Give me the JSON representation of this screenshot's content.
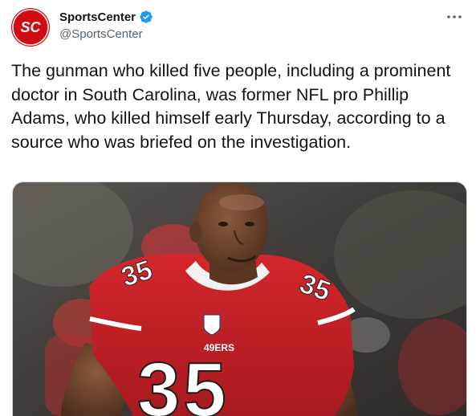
{
  "tweet": {
    "author": {
      "display_name": "SportsCenter",
      "handle": "@SportsCenter",
      "verified": true,
      "avatar_text": "SC"
    },
    "text": "The gunman who killed five people, including a prominent doctor in South Carolina, was former NFL pro Phillip Adams, who killed himself early Thursday, according to a source who was briefed on the investigation.",
    "media": {
      "jersey_number": "35",
      "jersey_lettering": "49ERS"
    }
  },
  "colors": {
    "brand_red": "#d20a11",
    "verified_blue": "#1d9bf0",
    "secondary_text": "#536471"
  },
  "icons": {
    "more": "more-dots-icon",
    "verified": "verified-badge-icon"
  }
}
